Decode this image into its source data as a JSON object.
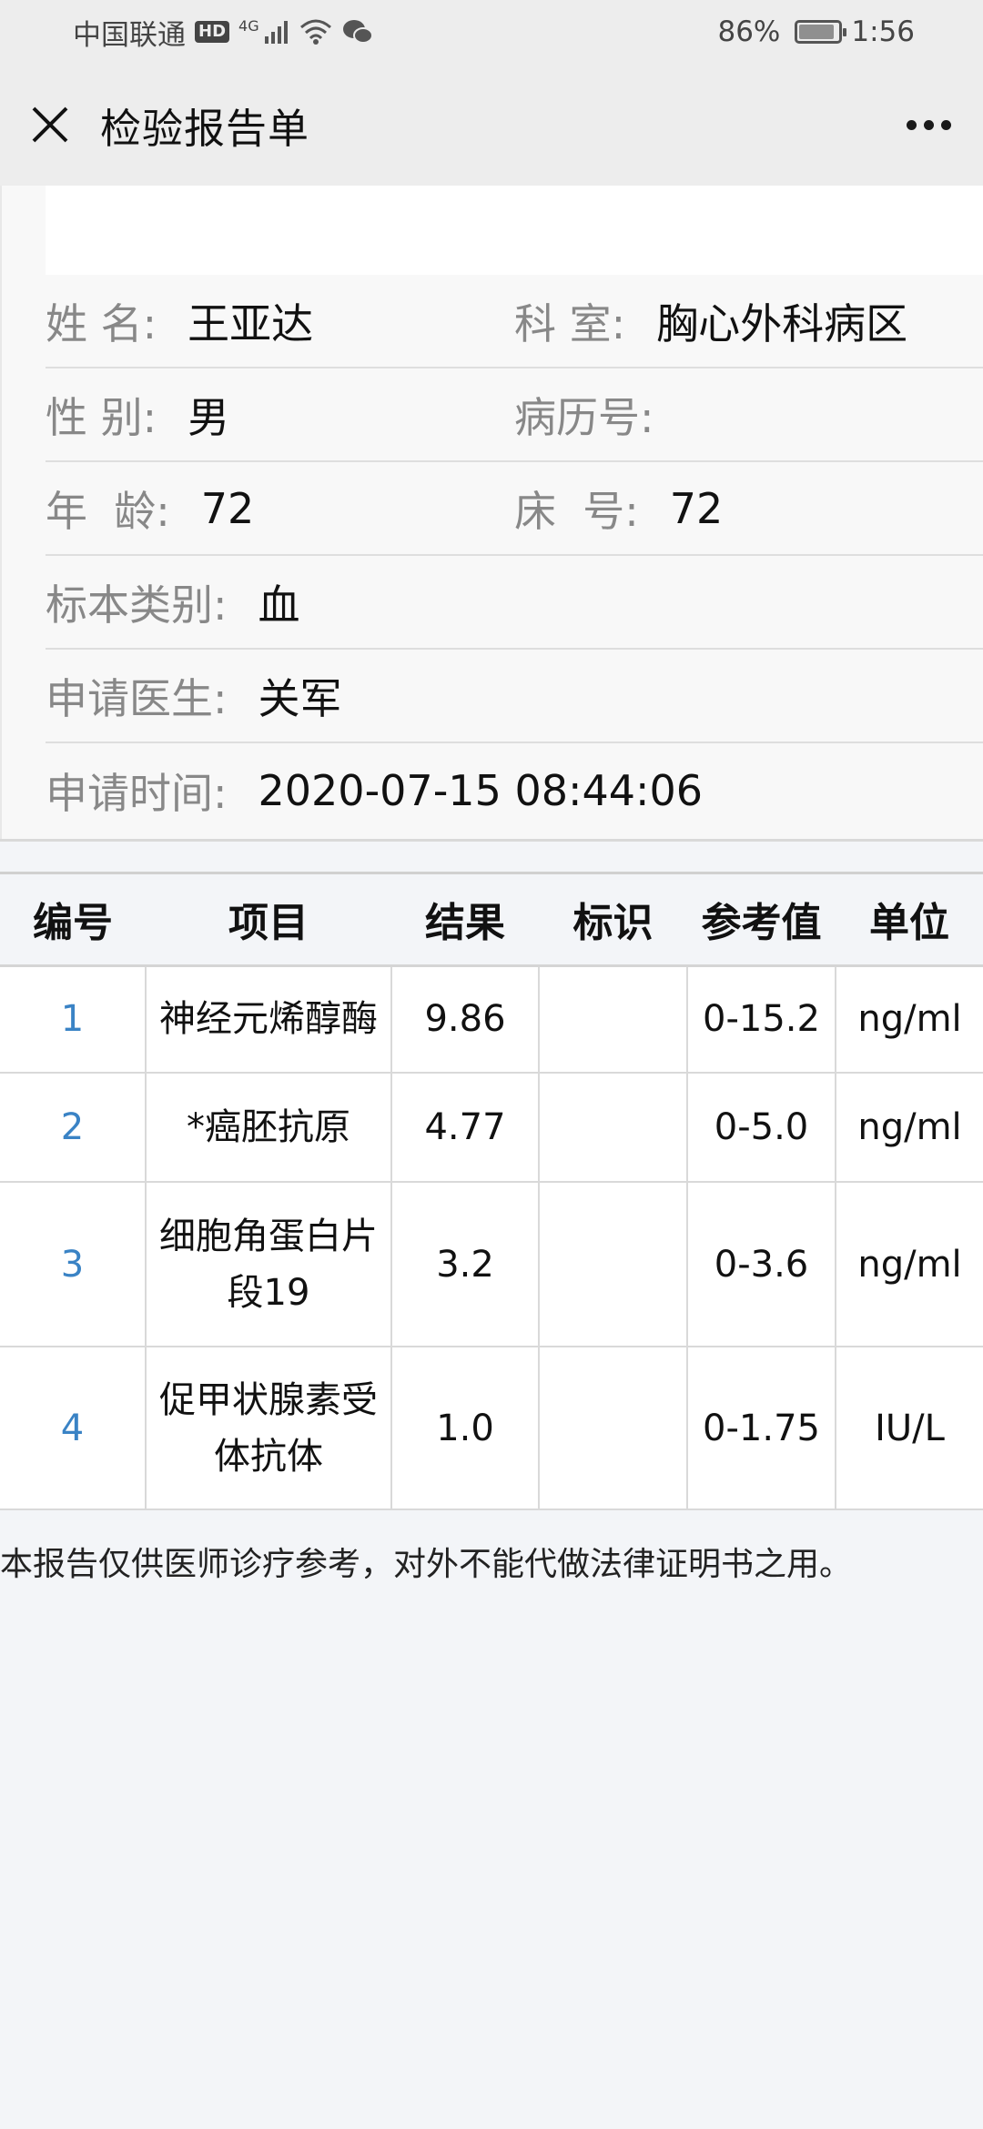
{
  "status_bar": {
    "carrier": "中国联通",
    "hd": "HD",
    "network": "4G",
    "battery": "86%",
    "time": "1:56"
  },
  "nav": {
    "title": "检验报告单"
  },
  "patient": {
    "name_label": "姓 名:",
    "name_value": "王亚达",
    "dept_label": "科 室:",
    "dept_value": "胸心外科病区",
    "sex_label": "性 别:",
    "sex_value": "男",
    "record_label": "病历号:",
    "record_value": "",
    "age_label": "年  龄:",
    "age_value": "72",
    "bed_label": "床  号:",
    "bed_value": "72",
    "sample_label": "标本类别:",
    "sample_value": "血",
    "doctor_label": "申请医生:",
    "doctor_value": "关军",
    "time_label": "申请时间:",
    "time_value": "2020-07-15 08:44:06"
  },
  "table": {
    "headers": [
      "编号",
      "项目",
      "结果",
      "标识",
      "参考值",
      "单位"
    ],
    "rows": [
      {
        "no": "1",
        "item": "神经元烯醇酶",
        "result": "9.86",
        "flag": "",
        "ref": "0-15.2",
        "unit": "ng/ml"
      },
      {
        "no": "2",
        "item": "*癌胚抗原",
        "result": "4.77",
        "flag": "",
        "ref": "0-5.0",
        "unit": "ng/ml"
      },
      {
        "no": "3",
        "item": "细胞角蛋白片段19",
        "result": "3.2",
        "flag": "",
        "ref": "0-3.6",
        "unit": "ng/ml"
      },
      {
        "no": "4",
        "item": "促甲状腺素受体抗体",
        "result": "1.0",
        "flag": "",
        "ref": "0-1.75",
        "unit": "IU/L"
      }
    ]
  },
  "footer": {
    "note": "本报告仅供医师诊疗参考，对外不能代做法律证明书之用。"
  }
}
